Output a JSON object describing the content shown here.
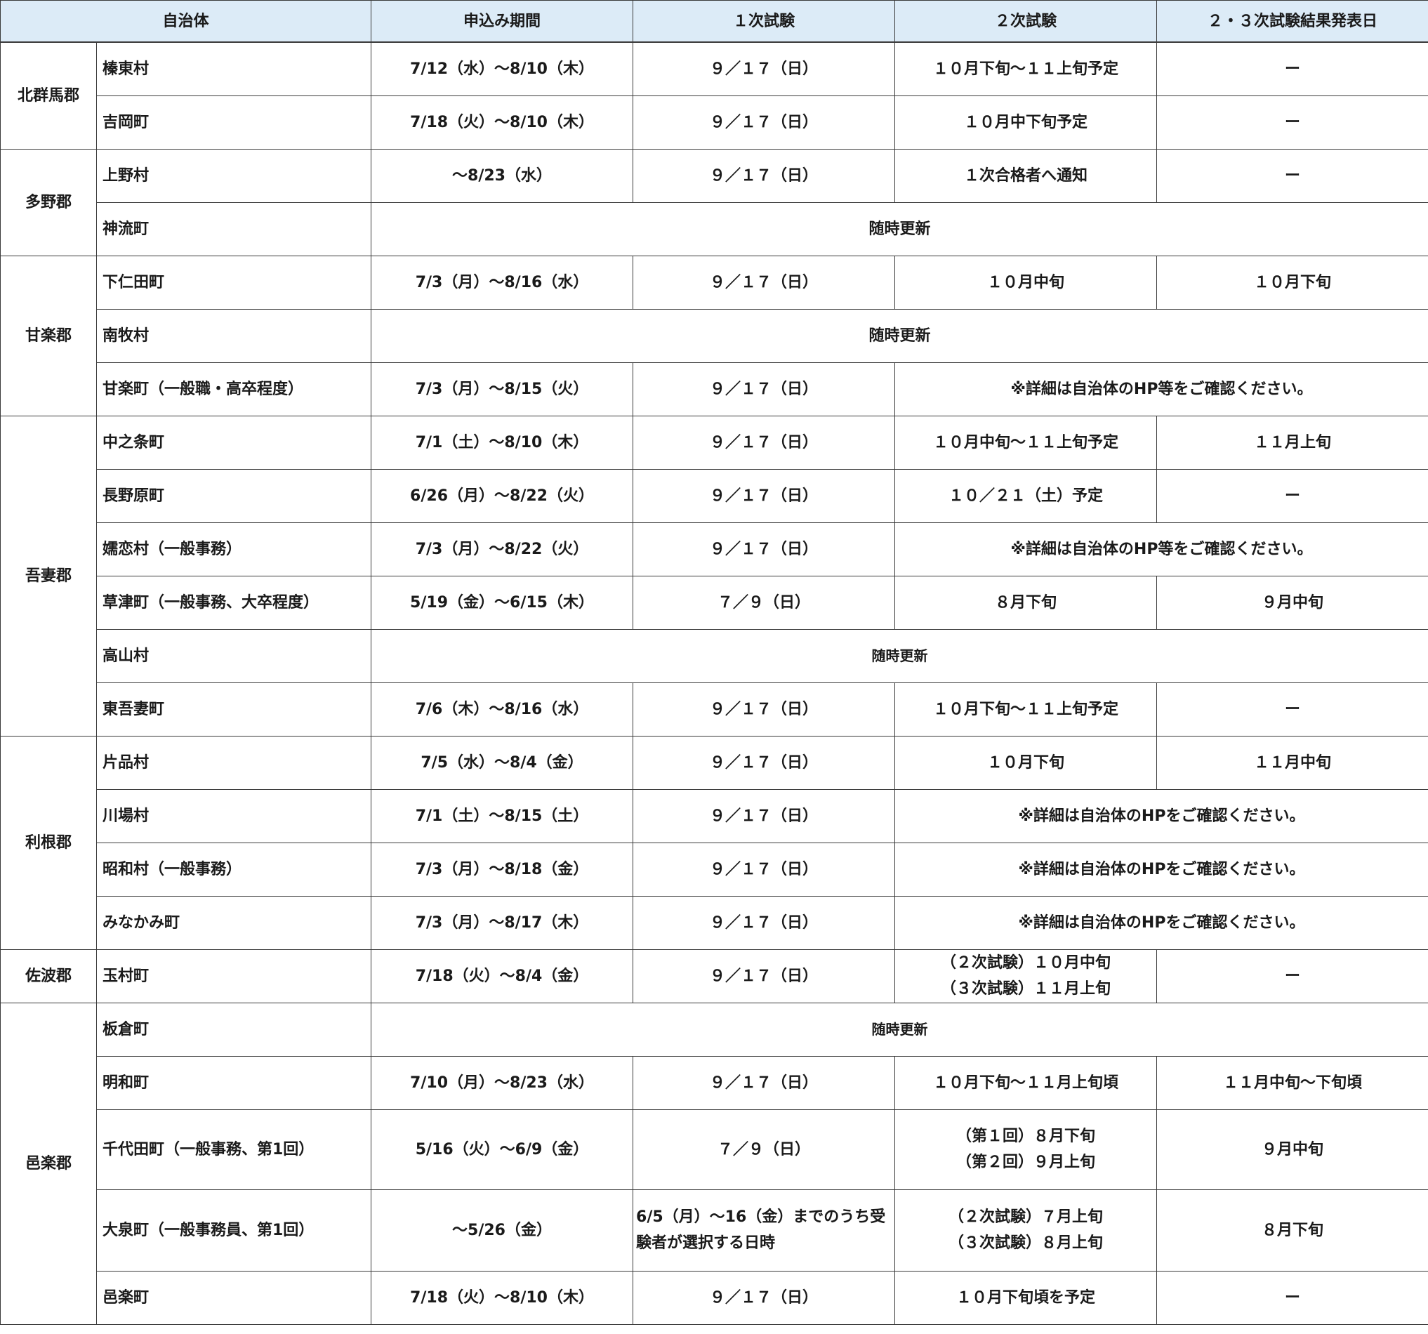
{
  "headers": [
    "自治体",
    "申込み期間",
    "１次試験",
    "２次試験",
    "２・３次試験結果発表日"
  ],
  "groups": [
    {
      "name": "北群馬郡",
      "rows": [
        {
          "municipality": "榛東村",
          "application": "7/12（水）～8/10（木）",
          "exam1": "９／１７（日）",
          "exam2": "１０月下旬～１１上旬予定",
          "result": "ー"
        },
        {
          "municipality": "吉岡町",
          "application": "7/18（火）～8/10（木）",
          "exam1": "９／１７（日）",
          "exam2": "１０月中下旬予定",
          "result": "ー"
        }
      ]
    },
    {
      "name": "多野郡",
      "rows": [
        {
          "municipality": "上野村",
          "application": "～8/23（水）",
          "exam1": "９／１７（日）",
          "exam2": "１次合格者へ通知",
          "result": "ー"
        },
        {
          "municipality": "神流町",
          "note": "随時更新"
        }
      ]
    },
    {
      "name": "甘楽郡",
      "rows": [
        {
          "municipality": "下仁田町",
          "application": "7/3（月）～8/16（水）",
          "exam1": "９／１７（日）",
          "exam2": "１０月中旬",
          "result": "１０月下旬"
        },
        {
          "municipality": "南牧村",
          "note": "随時更新"
        },
        {
          "municipality": "甘楽町（一般職・高卒程度）",
          "application": "7/3（月）～8/15（火）",
          "exam1": "９／１７（日）",
          "note_span2": "※詳細は自治体のHP等をご確認ください。"
        }
      ]
    },
    {
      "name": "吾妻郡",
      "rows": [
        {
          "municipality": "中之条町",
          "application": "7/1（土）～8/10（木）",
          "exam1": "９／１７（日）",
          "exam2": "１０月中旬～１１上旬予定",
          "result": "１１月上旬"
        },
        {
          "municipality": "長野原町",
          "application": "6/26（月）～8/22（火）",
          "exam1": "９／１７（日）",
          "exam2": "１０／２１（土）予定",
          "result": "ー"
        },
        {
          "municipality": "嬬恋村（一般事務）",
          "application": "7/3（月）～8/22（火）",
          "exam1": "９／１７（日）",
          "note_span2": "※詳細は自治体のHP等をご確認ください。"
        },
        {
          "municipality": "草津町（一般事務、大卒程度）",
          "application": "5/19（金）～6/15（木）",
          "exam1": "７／９（日）",
          "exam2": "８月下旬",
          "result": "９月中旬"
        },
        {
          "municipality": "高山村",
          "note": "随時更新"
        },
        {
          "municipality": "東吾妻町",
          "application": "7/6（木）～8/16（水）",
          "exam1": "９／１７（日）",
          "exam2": "１０月下旬～１１上旬予定",
          "result": "ー"
        }
      ]
    },
    {
      "name": "利根郡",
      "rows": [
        {
          "municipality": "片品村",
          "application": "7/5（水）～8/4（金）",
          "exam1": "９／１７（日）",
          "exam2": "１０月下旬",
          "result": "１１月中旬"
        },
        {
          "municipality": "川場村",
          "application": "7/1（土）～8/15（土）",
          "exam1": "９／１７（日）",
          "note_span2": "※詳細は自治体のHPをご確認ください。"
        },
        {
          "municipality": "昭和村（一般事務）",
          "application": "7/3（月）～8/18（金）",
          "exam1": "９／１７（日）",
          "note_span2": "※詳細は自治体のHPをご確認ください。"
        },
        {
          "municipality": "みなかみ町",
          "application": "7/3（月）～8/17（木）",
          "exam1": "９／１７（日）",
          "note_span2": "※詳細は自治体のHPをご確認ください。"
        }
      ]
    },
    {
      "name": "佐波郡",
      "rows": [
        {
          "municipality": "玉村町",
          "application": "7/18（火）～8/4（金）",
          "exam1": "９／１７（日）",
          "exam2_lines": [
            "（２次試験）１０月中旬",
            "（３次試験）１１月上旬"
          ],
          "result": "ー"
        }
      ]
    },
    {
      "name": "邑楽郡",
      "rows": [
        {
          "municipality": "板倉町",
          "note": "随時更新"
        },
        {
          "municipality": "明和町",
          "application": "7/10（月）～8/23（水）",
          "exam1": "９／１７（日）",
          "exam2": "１０月下旬～１１月上旬頃",
          "result": "１１月中旬～下旬頃"
        },
        {
          "municipality": "千代田町（一般事務、第1回）",
          "application": "5/16（火）～6/9（金）",
          "exam1": "７／９（日）",
          "exam2_lines": [
            "（第１回）８月下旬",
            "（第２回）９月上旬"
          ],
          "result": "９月中旬"
        },
        {
          "municipality": "大泉町（一般事務員、第1回）",
          "application": "～5/26（金）",
          "exam1": "6/5（月）～16（金）までのうち受験者が選択する日時",
          "exam2_lines": [
            "（２次試験）７月上旬",
            "（３次試験）８月上旬"
          ],
          "result": "８月下旬"
        },
        {
          "municipality": "邑楽町",
          "application": "7/18（火）～8/10（木）",
          "exam1": "９／１７（日）",
          "exam2": "１０月下旬頃を予定",
          "result": "ー"
        }
      ]
    }
  ]
}
